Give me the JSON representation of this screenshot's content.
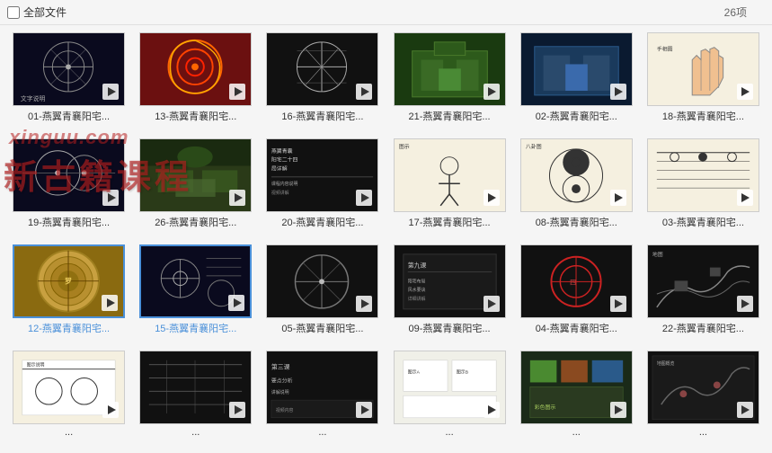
{
  "topbar": {
    "select_all_label": "全部文件",
    "count_label": "26项"
  },
  "watermark": {
    "line1": "xinguu.com",
    "line2": "新古籍课程"
  },
  "videos": [
    {
      "id": "v01",
      "label": "01-燕翼青襄阳宅...",
      "thumb_class": "thumb-01",
      "theme": "diagram-circle"
    },
    {
      "id": "v13",
      "label": "13-燕翼青襄阳宅...",
      "thumb_class": "thumb-13",
      "theme": "red-spiral"
    },
    {
      "id": "v16",
      "label": "16-燕翼青襄阳宅...",
      "thumb_class": "thumb-16",
      "theme": "diagram-lines"
    },
    {
      "id": "v21",
      "label": "21-燕翼青襄阳宅...",
      "thumb_class": "thumb-21",
      "theme": "green-building"
    },
    {
      "id": "v02",
      "label": "02-燕翼青襄阳宅...",
      "thumb_class": "thumb-02",
      "theme": "building-blue"
    },
    {
      "id": "v18",
      "label": "18-燕翼青襄阳宅...",
      "thumb_class": "thumb-18",
      "theme": "hand-diagram"
    },
    {
      "id": "v19",
      "label": "19-燕翼青襄阳宅...",
      "thumb_class": "thumb-19",
      "theme": "diagram-circle2"
    },
    {
      "id": "v26",
      "label": "26-燕翼青襄阳宅...",
      "thumb_class": "thumb-26",
      "theme": "aerial-green"
    },
    {
      "id": "v20",
      "label": "20-燕翼青襄阳宅...",
      "thumb_class": "thumb-20",
      "theme": "dark-text"
    },
    {
      "id": "v17",
      "label": "17-燕翼青襄阳宅...",
      "thumb_class": "thumb-17",
      "theme": "figure-white"
    },
    {
      "id": "v08",
      "label": "08-燕翼青襄阳宅...",
      "thumb_class": "thumb-08",
      "theme": "bagua-white"
    },
    {
      "id": "v03",
      "label": "03-燕翼青襄阳宅...",
      "thumb_class": "thumb-03",
      "theme": "diagram-white"
    },
    {
      "id": "v12",
      "label": "12-燕翼青襄阳宅...",
      "thumb_class": "thumb-12",
      "theme": "compass-gold",
      "selected": true
    },
    {
      "id": "v15",
      "label": "15-燕翼青襄阳宅...",
      "thumb_class": "thumb-15",
      "theme": "diagram-dark",
      "selected": true
    },
    {
      "id": "v05",
      "label": "05-燕翼青襄阳宅...",
      "thumb_class": "thumb-05",
      "theme": "dark-diagram"
    },
    {
      "id": "v09",
      "label": "09-燕翼青襄阳宅...",
      "thumb_class": "thumb-09",
      "theme": "dark-text2"
    },
    {
      "id": "v04",
      "label": "04-燕翼青襄阳宅...",
      "thumb_class": "thumb-04",
      "theme": "red-circle"
    },
    {
      "id": "v22",
      "label": "22-燕翼青襄阳宅...",
      "thumb_class": "thumb-22",
      "theme": "map-dark"
    },
    {
      "id": "vr1",
      "label": "...",
      "thumb_class": "thumb-r5a",
      "theme": "white-diagram"
    },
    {
      "id": "vr2",
      "label": "...",
      "thumb_class": "thumb-r5b",
      "theme": "dark-diagram2"
    },
    {
      "id": "vr3",
      "label": "...",
      "thumb_class": "thumb-r5c",
      "theme": "dark-text3"
    },
    {
      "id": "vr4",
      "label": "...",
      "thumb_class": "thumb-r5d",
      "theme": "light-diagram"
    },
    {
      "id": "vr5",
      "label": "...",
      "thumb_class": "thumb-r5e",
      "theme": "colorful"
    },
    {
      "id": "vr6",
      "label": "...",
      "thumb_class": "thumb-r5f",
      "theme": "dark-map"
    }
  ]
}
